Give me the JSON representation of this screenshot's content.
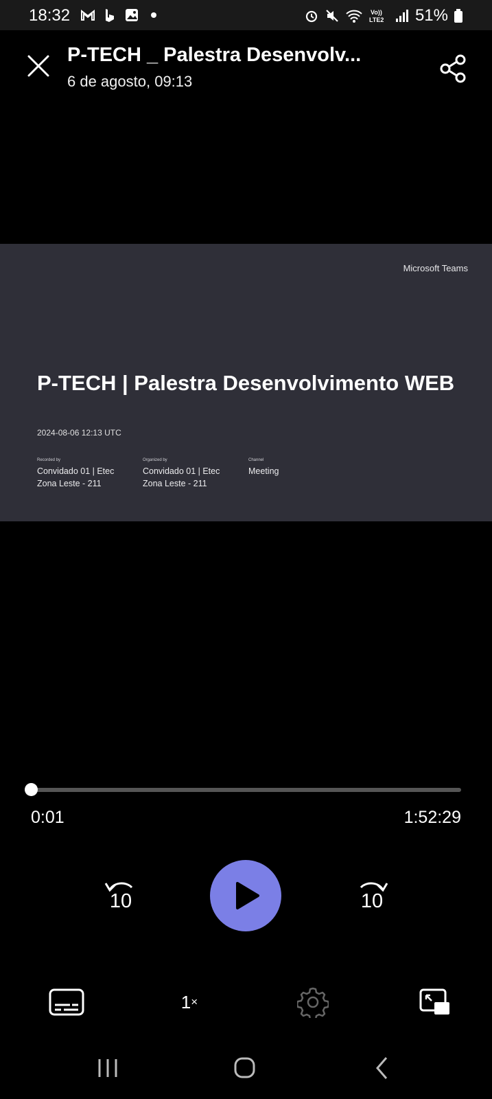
{
  "status_bar": {
    "time": "18:32",
    "left_icons": [
      "gmail-icon",
      "bing-icon",
      "gallery-icon",
      "dot-icon"
    ],
    "right_icons": [
      "alarm-icon",
      "mute-icon",
      "wifi-icon",
      "volte-lte2-icon",
      "signal-icon",
      "battery-icon"
    ],
    "battery_percent": "51%"
  },
  "header": {
    "title": "P-TECH _ Palestra Desenvolv...",
    "subtitle": "6 de agosto, 09:13"
  },
  "video_frame": {
    "brand": "Microsoft Teams",
    "title": "P-TECH | Palestra Desenvolvimento WEB",
    "date": "2024-08-06 12:13 UTC",
    "meta": [
      {
        "label": "Recorded by",
        "value": "Convidado 01 | Etec Zona Leste - 211"
      },
      {
        "label": "Organized by",
        "value": "Convidado 01 | Etec Zona Leste - 211"
      },
      {
        "label": "Channel",
        "value": "Meeting"
      }
    ],
    "background": "#2f2f38"
  },
  "player": {
    "current_time": "0:01",
    "duration": "1:52:29",
    "progress_fraction": 0.0002,
    "rewind_label": "10",
    "forward_label": "10",
    "speed_label": "1",
    "speed_suffix": "×",
    "accent": "#7b7fe6"
  }
}
